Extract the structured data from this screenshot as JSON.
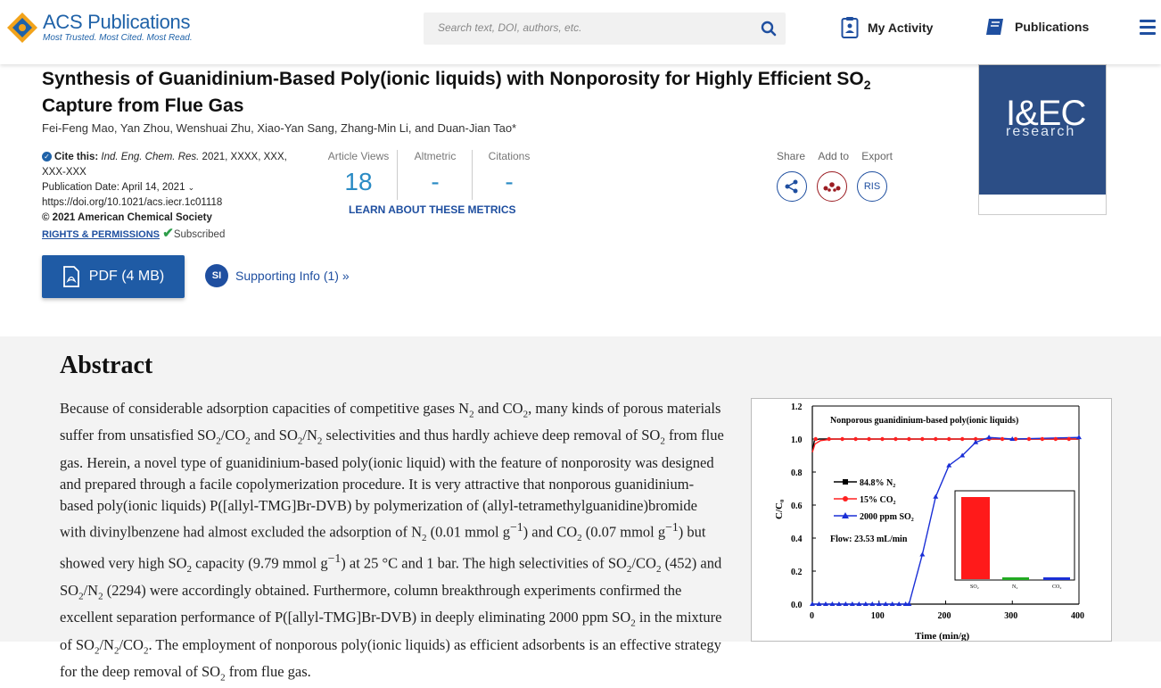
{
  "header": {
    "logo_name": "ACS Publications",
    "logo_tagline": "Most Trusted. Most Cited. Most Read.",
    "search_placeholder": "Search text, DOI, authors, etc.",
    "my_activity": "My Activity",
    "publications": "Publications"
  },
  "article": {
    "title_part1": "Synthesis of Guanidinium-Based Poly(ionic liquids) with Nonporosity for Highly Efficient SO",
    "title_sub": "2",
    "title_part2": " Capture from Flue Gas",
    "authors": "Fei-Feng Mao, Yan Zhou, Wenshuai Zhu, Xiao-Yan Sang, Zhang-Min Li, and Duan-Jian Tao*",
    "cite_label": "Cite this:",
    "cite_journal": "Ind. Eng. Chem. Res.",
    "cite_rest": " 2021, XXXX, XXX, XXX-XXX",
    "pub_date": "Publication Date: April 14, 2021",
    "doi": "https://doi.org/10.1021/acs.iecr.1c01118",
    "copyright": "© 2021 American Chemical Society",
    "rights": "RIGHTS & PERMISSIONS",
    "subscribed": "Subscribed"
  },
  "metrics": {
    "views_label": "Article Views",
    "views_value": "18",
    "altmetric_label": "Altmetric",
    "altmetric_value": "-",
    "citations_label": "Citations",
    "citations_value": "-",
    "learn": "LEARN ABOUT THESE METRICS"
  },
  "tools": {
    "share": "Share",
    "add_to": "Add to",
    "export": "Export",
    "ris": "RIS"
  },
  "cover": {
    "title": "I&EC",
    "subtitle": "research"
  },
  "actions": {
    "pdf": "PDF (4 MB)",
    "si_badge": "SI",
    "supporting": "Supporting Info (1) »"
  },
  "abstract": {
    "heading": "Abstract",
    "text_html": "Because of considerable adsorption capacities of competitive gases N<sub>2</sub> and CO<sub>2</sub>, many kinds of porous materials suffer from unsatisfied SO<sub>2</sub>/CO<sub>2</sub> and SO<sub>2</sub>/N<sub>2</sub> selectivities and thus hardly achieve deep removal of SO<sub>2</sub> from flue gas. Herein, a novel type of guanidinium-based poly(ionic liquid) with the feature of nonporosity was designed and prepared through a facile copolymerization procedure. It is very attractive that nonporous guanidinium-based poly(ionic liquids) P([allyl-TMG]Br-DVB) by polymerization of (allyl-tetramethylguanidine)bromide with divinylbenzene had almost excluded the adsorption of N<sub>2</sub> (0.01 mmol g<sup>−1</sup>) and CO<sub>2</sub> (0.07 mmol g<sup>−1</sup>) but showed very high SO<sub>2</sub> capacity (9.79 mmol g<sup>−1</sup>) at 25 °C and 1 bar. The high selectivities of SO<sub>2</sub>/CO<sub>2</sub> (452) and SO<sub>2</sub>/N<sub>2</sub> (2294) were accordingly obtained. Furthermore, column breakthrough experiments confirmed the excellent separation performance of P([allyl-TMG]Br-DVB) in deeply eliminating 2000 ppm SO<sub>2</sub> in the mixture of SO<sub>2</sub>/N<sub>2</sub>/CO<sub>2</sub>. The employment of nonporous poly(ionic liquids) as efficient adsorbents is an effective strategy for the deep removal of SO<sub>2</sub> from flue gas."
  },
  "toc_graphic": {
    "title": "Nonporous guanidinium-based poly(ionic liquids)",
    "flow": "Flow: 23.53 mL/min",
    "legend_n2": "84.8% N₂",
    "legend_co2": "15% CO₂",
    "legend_so2": "2000 ppm SO₂",
    "xlabel": "Time (min/g)",
    "ylabel": "C/C₀",
    "yticks": [
      "0.0",
      "0.2",
      "0.4",
      "0.6",
      "0.8",
      "1.0",
      "1.2"
    ],
    "xticks": [
      "0",
      "100",
      "200",
      "300",
      "400"
    ],
    "inset_labels": [
      "SO₂",
      "N₂",
      "CO₂"
    ],
    "colors": {
      "n2": "#000000",
      "co2": "#ff2020",
      "so2": "#1a2fd6"
    }
  }
}
